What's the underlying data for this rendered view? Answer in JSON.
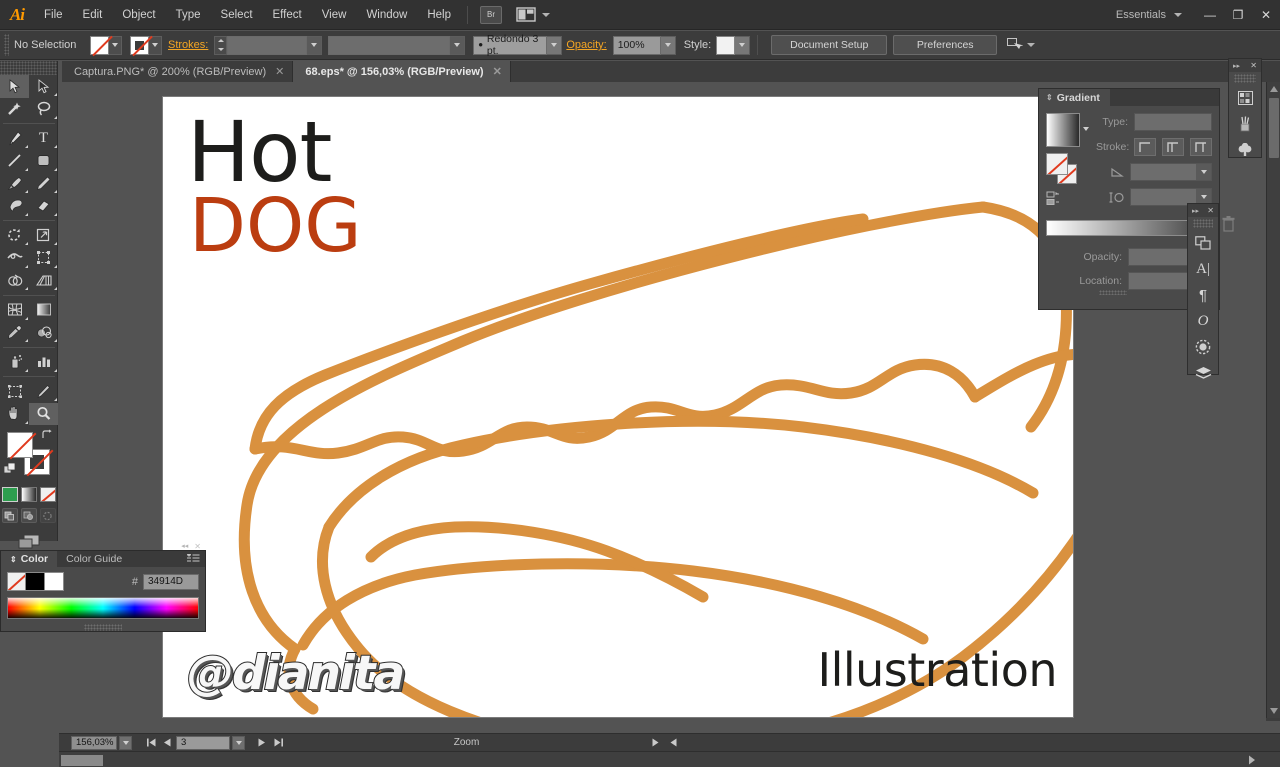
{
  "app": {
    "logo": "Ai",
    "title_tooltip": "Adobe Illustrator"
  },
  "menubar": {
    "items": [
      "File",
      "Edit",
      "Object",
      "Type",
      "Select",
      "Effect",
      "View",
      "Window",
      "Help"
    ],
    "bridge_icon": "Br",
    "arrange_icon": "arrange-documents-icon",
    "workspace": "Essentials",
    "window_controls": {
      "minimize": "—",
      "maximize": "❐",
      "close": "✕"
    }
  },
  "control_bar": {
    "selection_status": "No Selection",
    "fill_swatch": "none",
    "stroke_swatch": "none",
    "stroke_label": "Strokes:",
    "stroke_weight": "",
    "stroke_profile": "",
    "brush_definition": "Redondo 3 pt.",
    "opacity_label": "Opacity:",
    "opacity_value": "100%",
    "style_label": "Style:",
    "document_setup": "Document Setup",
    "preferences": "Preferences"
  },
  "tabs": [
    {
      "label": "Captura.PNG* @ 200% (RGB/Preview)",
      "active": false,
      "close": "✕"
    },
    {
      "label": "68.eps* @ 156,03% (RGB/Preview)",
      "active": true,
      "close": "✕"
    }
  ],
  "toolbar": {
    "tools": [
      "selection-tool",
      "direct-selection-tool",
      "magic-wand-tool",
      "lasso-tool",
      "pen-tool",
      "type-tool",
      "line-segment-tool",
      "rectangle-tool",
      "paintbrush-tool",
      "pencil-tool",
      "blob-brush-tool",
      "eraser-tool",
      "rotate-tool",
      "scale-tool",
      "width-tool",
      "free-transform-tool",
      "shape-builder-tool",
      "perspective-grid-tool",
      "mesh-tool",
      "gradient-tool",
      "eyedropper-tool",
      "blend-tool",
      "symbol-sprayer-tool",
      "column-graph-tool",
      "artboard-tool",
      "slice-tool",
      "hand-tool",
      "zoom-tool"
    ],
    "fill_color": "none",
    "stroke_color": "none",
    "color_modes": [
      "color-mode",
      "gradient-mode",
      "none-mode"
    ],
    "drawing_modes": [
      "draw-normal",
      "draw-behind",
      "draw-inside"
    ],
    "screen_mode": "change-screen-mode"
  },
  "artwork": {
    "headline_top": "Hot",
    "headline_bottom": "DOG",
    "headline_top_color": "#1d1d1b",
    "headline_bottom_color": "#bb3d10",
    "signature": "@dianita",
    "caption": "Illustration",
    "line_color": "#d9913f",
    "background": "#ffffff"
  },
  "gradient_panel": {
    "title": "Gradient",
    "type_label": "Type:",
    "type_value": "",
    "stroke_label": "Stroke:",
    "angle_label": "angle",
    "angle_value": "",
    "aspect_label": "aspect-ratio",
    "aspect_value": "",
    "opacity_label": "Opacity:",
    "opacity_value": "",
    "location_label": "Location:",
    "location_value": "",
    "stroke_buttons": [
      "stroke-within",
      "stroke-along",
      "stroke-across"
    ]
  },
  "mini_panels": {
    "top": {
      "icons": [
        "swatches-icon",
        "brushes-icon",
        "symbols-icon"
      ],
      "collapse": "▸▸",
      "close": "✕"
    },
    "lower": {
      "icons": [
        "layers-icon",
        "character-icon",
        "paragraph-icon",
        "glyphs-icon",
        "transparency-icon",
        "appearance-icon"
      ],
      "collapse": "▸▸",
      "close": "✕"
    }
  },
  "color_panel": {
    "tabs": [
      {
        "label": "Color",
        "active": true
      },
      {
        "label": "Color Guide",
        "active": false
      }
    ],
    "menu_icon": "panel-menu-icon",
    "hex_symbol": "#",
    "hex_value": "34914D",
    "swatch_none": "none",
    "swatch_black": "#000000",
    "swatch_white": "#ffffff"
  },
  "status_bar": {
    "zoom_value": "156,03%",
    "artboard_number": "3",
    "status_label": "Zoom",
    "first_icon": "first-artboard-icon",
    "prev_icon": "previous-artboard-icon",
    "next_icon": "next-artboard-icon",
    "last_icon": "last-artboard-icon"
  },
  "colors": {
    "chrome_dark": "#323232",
    "chrome_mid": "#3c3c3c",
    "panel_bg": "#4a4a4a",
    "canvas_bg": "#535353",
    "accent_orange": "#f5a623",
    "art_orange": "#d9913f"
  }
}
